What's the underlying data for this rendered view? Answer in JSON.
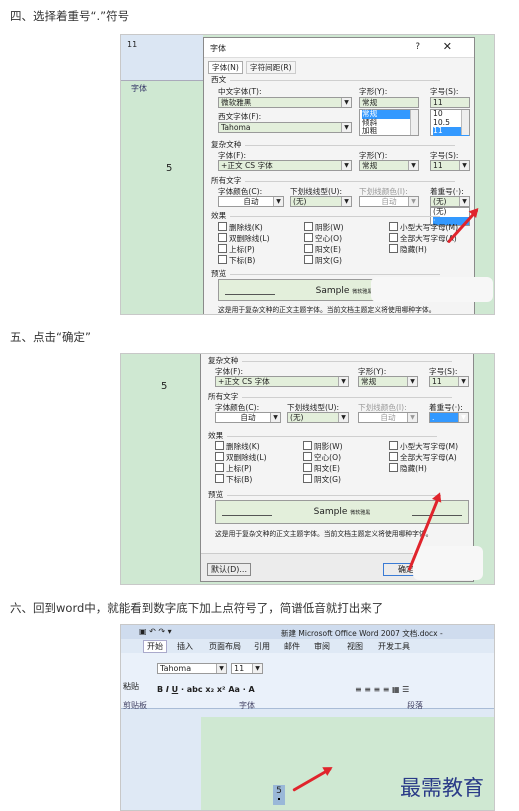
{
  "steps": {
    "s4": "四、选择着重号“.”符号",
    "s5": "五、点击“确定”",
    "s6": "六、回到word中，就能看到数字底下加上点符号了，简谱低音就打出来了"
  },
  "doc_number": "5",
  "watermark": "最需教育",
  "dialog": {
    "title": "字体",
    "help": "?",
    "close": "✕",
    "tab_font": "字体(N)",
    "tab_adv": "字符间距(R)",
    "west_label": "西文",
    "cn_font_label": "中文字体(T):",
    "cn_font": "微软雅黑",
    "west_font_label": "西文字体(F):",
    "west_font": "Tahoma",
    "style_label": "字形(Y):",
    "style": "常规",
    "styles": [
      "常规",
      "倾斜",
      "加粗"
    ],
    "size_label": "字号(S):",
    "size": "11",
    "sizes": [
      "10",
      "10.5",
      "11"
    ],
    "complex_label": "复杂文种",
    "cfont_label": "字体(F):",
    "cfont": "+正文 CS 字体",
    "all_label": "所有文字",
    "color_label": "字体颜色(C):",
    "color": "自动",
    "underline_label": "下划线线型(U):",
    "underline": "(无)",
    "ucolor_label": "下划线颜色(I):",
    "ucolor": "自动",
    "emph_label": "着重号(·):",
    "emph": "(无)",
    "emph_opts": [
      "(无)",
      "·"
    ],
    "effects_label": "效果",
    "effects": [
      "删除线(K)",
      "双删除线(L)",
      "上标(P)",
      "下标(B)",
      "阴影(W)",
      "空心(O)",
      "阳文(E)",
      "阴文(G)",
      "小型大写字母(M)",
      "全部大写字母(A)",
      "隐藏(H)"
    ],
    "preview_label": "预览",
    "sample": "Sample",
    "sample_cn": "微软雅黑",
    "note": "这是用于复杂文种的正文主题字体。当前文档主题定义将使用哪种字体。",
    "default_btn": "默认(D)...",
    "ok_btn": "确定",
    "dot": "."
  },
  "word": {
    "title": "新建 Microsoft Office Word 2007 文档.docx -",
    "tabs": [
      "开始",
      "插入",
      "页面布局",
      "引用",
      "邮件",
      "审阅",
      "视图",
      "开发工具"
    ],
    "font": "Tahoma",
    "size": "11",
    "grp_font": "字体",
    "grp_para": "段落",
    "paste": "粘贴",
    "clip": "剪贴板"
  }
}
